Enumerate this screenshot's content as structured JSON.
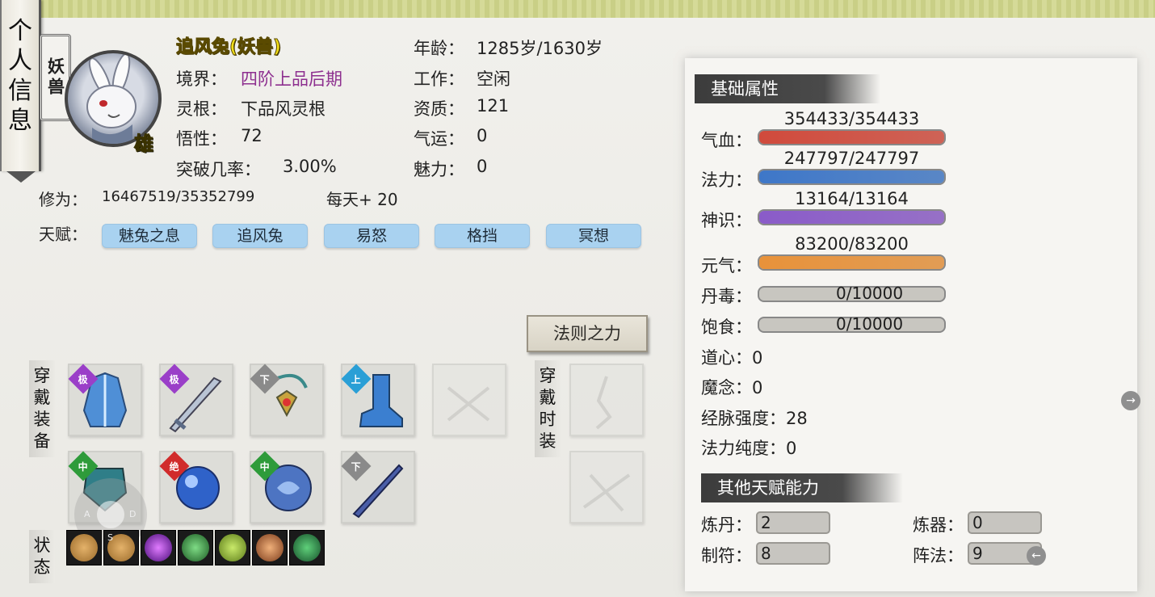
{
  "header": {
    "tab_title": "个人信息"
  },
  "profile": {
    "race_tag": "妖兽",
    "gender": "雄",
    "name": "追风兔(妖兽)",
    "realm_label": "境界：",
    "realm_value": "四阶上品后期",
    "root_label": "灵根：",
    "root_value": "下品风灵根",
    "comprehension_label": "悟性：",
    "comprehension_value": "72",
    "breakthrough_label": "突破几率：",
    "breakthrough_value": "3.00%",
    "age_label": "年龄：",
    "age_value": "1285岁/1630岁",
    "job_label": "工作：",
    "job_value": "空闲",
    "aptitude_label": "资质：",
    "aptitude_value": "121",
    "luck_label": "气运：",
    "luck_value": "0",
    "charm_label": "魅力：",
    "charm_value": "0",
    "cultivation_label": "修为：",
    "cultivation_value": "16467519/35352799",
    "daily_label": "每天+ 20"
  },
  "talents": {
    "label": "天赋：",
    "items": [
      "魅兔之息",
      "追风兔",
      "易怒",
      "格挡",
      "冥想"
    ]
  },
  "law_button": "法则之力",
  "equipment": {
    "label": "穿戴装备",
    "fashion_label": "穿戴时装",
    "slots": [
      {
        "icon": "robe-icon",
        "grade": "极",
        "grade_color": "#9a3fc8"
      },
      {
        "icon": "sword-icon",
        "grade": "极",
        "grade_color": "#9a3fc8"
      },
      {
        "icon": "amulet-icon",
        "grade": "下",
        "grade_color": "#8a8a8a"
      },
      {
        "icon": "boots-icon",
        "grade": "上",
        "grade_color": "#2a9fd6"
      },
      {
        "icon": "ring-slot-icon",
        "grade": "",
        "grade_color": ""
      },
      {
        "icon": "belt-icon",
        "grade": "中",
        "grade_color": "#2e9b3a"
      },
      {
        "icon": "orb-icon",
        "grade": "绝",
        "grade_color": "#d12b2b"
      },
      {
        "icon": "shield-icon",
        "grade": "中",
        "grade_color": "#2e9b3a"
      },
      {
        "icon": "dagger-icon",
        "grade": "下",
        "grade_color": "#8a8a8a"
      }
    ],
    "joystick": {
      "left": "A",
      "right": "D",
      "bottom": "S"
    }
  },
  "status": {
    "label": "状态",
    "effects": [
      "earth-orb-icon",
      "earth-orb-icon",
      "purple-vortex-icon",
      "wind-icon",
      "green-orb-icon",
      "pill-icon",
      "green-orb-icon"
    ]
  },
  "base_attributes": {
    "title": "基础属性",
    "hp": {
      "label": "气血：",
      "value": "354433/354433",
      "fraction": 1.0,
      "color": "#d04a3c"
    },
    "mp": {
      "label": "法力：",
      "value": "247797/247797",
      "fraction": 1.0,
      "color": "#3e77c8"
    },
    "sense": {
      "label": "神识：",
      "value": "13164/13164",
      "fraction": 1.0,
      "color": "#8a5bc8"
    },
    "vitality": {
      "label": "元气：",
      "value": "83200/83200",
      "fraction": 1.0,
      "color": "#e8923a"
    },
    "poison": {
      "label": "丹毒：",
      "value": "0/10000",
      "fraction": 0.0
    },
    "satiety": {
      "label": "饱食：",
      "value": "0/10000",
      "fraction": 0.0
    },
    "dao_heart": "道心：0",
    "demon_thought": "魔念：0",
    "meridian": "经脉强度：28",
    "purity": "法力纯度：0"
  },
  "other_talents": {
    "title": "其他天赋能力",
    "alchemy_label": "炼丹：",
    "alchemy_value": "2",
    "forging_label": "炼器：",
    "forging_value": "0",
    "talisman_label": "制符：",
    "talisman_value": "8",
    "formation_label": "阵法：",
    "formation_value": "9"
  },
  "nav": {
    "right_arrow": "→",
    "left_arrow": "←"
  }
}
